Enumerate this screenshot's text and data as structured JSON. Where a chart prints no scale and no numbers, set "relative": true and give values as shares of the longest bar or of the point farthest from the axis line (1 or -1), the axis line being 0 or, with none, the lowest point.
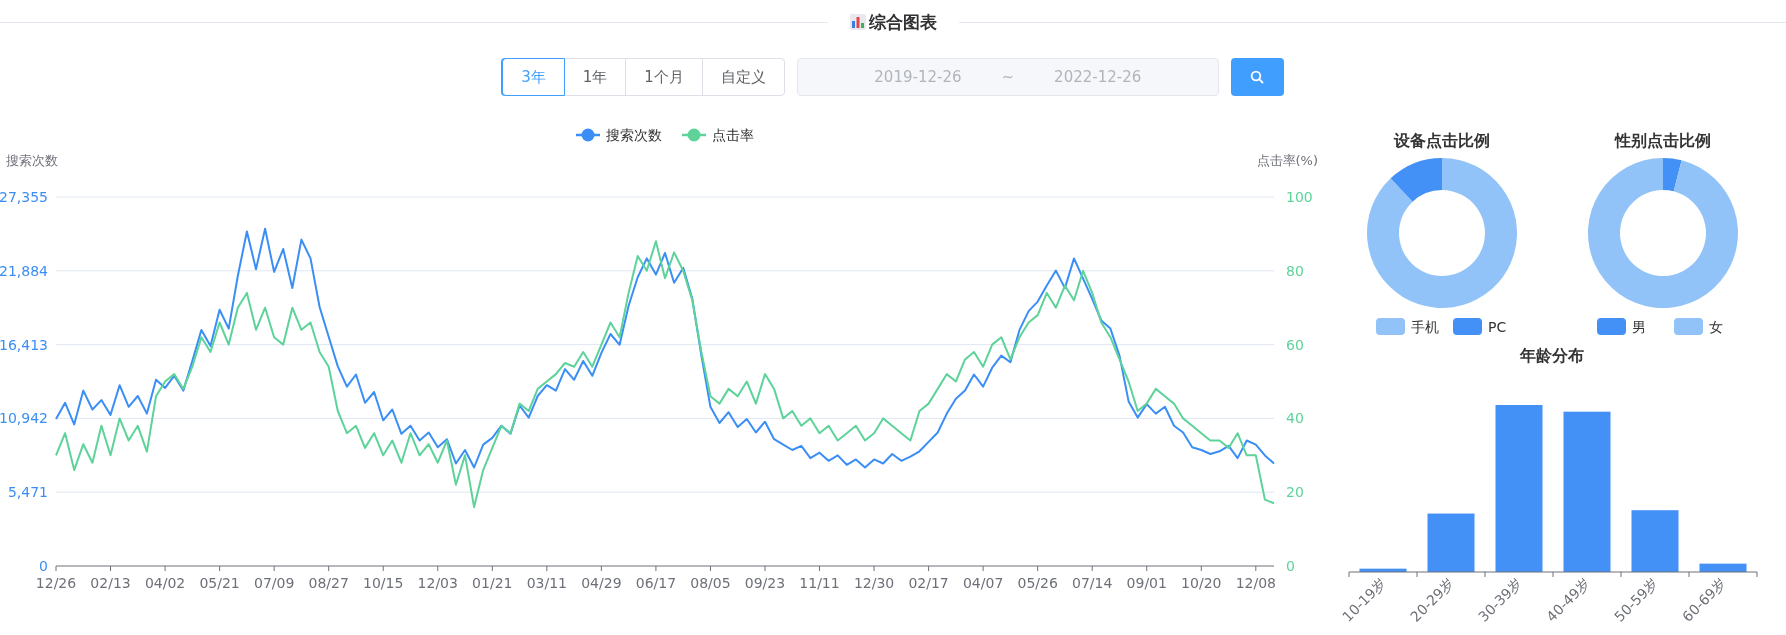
{
  "header": {
    "title": "综合图表"
  },
  "range_tabs": [
    {
      "label": "3年",
      "selected": true
    },
    {
      "label": "1年",
      "selected": false
    },
    {
      "label": "1个月",
      "selected": false
    },
    {
      "label": "自定义",
      "selected": false
    }
  ],
  "date_range": {
    "start": "2019-12-26",
    "separator": "~",
    "end": "2022-12-26",
    "disabled": true
  },
  "trend_chart": {
    "chart_data": {
      "type": "line",
      "legend": "top",
      "grid": true,
      "ylabel": "搜索次数",
      "y2label": "点击率(%)",
      "ylim": [
        0,
        27355
      ],
      "y2lim": [
        0,
        100
      ],
      "categories": [
        "12/26",
        null,
        null,
        null,
        null,
        null,
        "02/13",
        null,
        null,
        null,
        null,
        null,
        "04/02",
        null,
        null,
        null,
        null,
        null,
        "05/21",
        null,
        null,
        null,
        null,
        null,
        "07/09",
        null,
        null,
        null,
        null,
        null,
        "08/27",
        null,
        null,
        null,
        null,
        null,
        "10/15",
        null,
        null,
        null,
        null,
        null,
        "12/03",
        null,
        null,
        null,
        null,
        null,
        "01/21",
        null,
        null,
        null,
        null,
        null,
        "03/11",
        null,
        null,
        null,
        null,
        null,
        "04/29",
        null,
        null,
        null,
        null,
        null,
        "06/17",
        null,
        null,
        null,
        null,
        null,
        "08/05",
        null,
        null,
        null,
        null,
        null,
        "09/23",
        null,
        null,
        null,
        null,
        null,
        "11/11",
        null,
        null,
        null,
        null,
        null,
        "12/30",
        null,
        null,
        null,
        null,
        null,
        "02/17",
        null,
        null,
        null,
        null,
        null,
        "04/07",
        null,
        null,
        null,
        null,
        null,
        "05/26",
        null,
        null,
        null,
        null,
        null,
        "07/14",
        null,
        null,
        null,
        null,
        null,
        "09/01",
        null,
        null,
        null,
        null,
        null,
        "10/20",
        null,
        null,
        null,
        null,
        null,
        "12/08",
        null,
        null
      ],
      "yticks": [
        {
          "value": 0,
          "label": "0"
        },
        {
          "value": 5471,
          "label": "5,471"
        },
        {
          "value": 10942,
          "label": "10,942"
        },
        {
          "value": 16413,
          "label": "16,413"
        },
        {
          "value": 21884,
          "label": "21,884"
        },
        {
          "value": 27355,
          "label": "27,355"
        }
      ],
      "y2ticks": [
        0,
        20,
        40,
        60,
        80,
        100
      ],
      "series": [
        {
          "name": "搜索次数",
          "color": "#3a8ef5",
          "values": [
            10900,
            12100,
            10500,
            13000,
            11600,
            12300,
            11200,
            13400,
            11800,
            12600,
            11300,
            13800,
            13200,
            14100,
            13000,
            15200,
            17500,
            16300,
            19000,
            17600,
            21500,
            24800,
            22000,
            25000,
            21800,
            23500,
            20600,
            24200,
            22800,
            19200,
            17000,
            14800,
            13300,
            14200,
            12100,
            12900,
            10800,
            11600,
            9800,
            10400,
            9300,
            9900,
            8800,
            9400,
            7600,
            8600,
            7300,
            9000,
            9500,
            10400,
            9800,
            11900,
            11000,
            12600,
            13400,
            13000,
            14600,
            13800,
            15200,
            14100,
            15800,
            17200,
            16400,
            19300,
            21400,
            22800,
            21600,
            23200,
            21000,
            22100,
            19800,
            15600,
            11800,
            10600,
            11400,
            10300,
            10900,
            9900,
            10700,
            9400,
            9000,
            8600,
            8900,
            8000,
            8400,
            7800,
            8200,
            7500,
            7900,
            7300,
            7900,
            7600,
            8300,
            7800,
            8100,
            8500,
            9200,
            9900,
            11300,
            12400,
            13000,
            14200,
            13300,
            14700,
            15600,
            15100,
            17500,
            18900,
            19600,
            20800,
            21900,
            20600,
            22800,
            21300,
            19800,
            18200,
            17600,
            15600,
            12200,
            11000,
            12000,
            11300,
            11800,
            10400,
            9900,
            8800,
            8600,
            8300,
            8500,
            8900,
            8000,
            9300,
            9000,
            8200,
            7600
          ]
        },
        {
          "name": "点击率",
          "color": "#5dd39a",
          "axis": "y2",
          "values": [
            30,
            36,
            26,
            33,
            28,
            38,
            30,
            40,
            34,
            38,
            31,
            46,
            50,
            52,
            48,
            54,
            62,
            58,
            66,
            60,
            70,
            74,
            64,
            70,
            62,
            60,
            70,
            64,
            66,
            58,
            54,
            42,
            36,
            38,
            32,
            36,
            30,
            34,
            28,
            36,
            30,
            33,
            28,
            34,
            22,
            30,
            16,
            26,
            32,
            38,
            36,
            44,
            42,
            48,
            50,
            52,
            55,
            54,
            58,
            54,
            60,
            66,
            62,
            74,
            84,
            80,
            88,
            78,
            85,
            80,
            72,
            58,
            46,
            44,
            48,
            46,
            50,
            44,
            52,
            48,
            40,
            42,
            38,
            40,
            36,
            38,
            34,
            36,
            38,
            34,
            36,
            40,
            38,
            36,
            34,
            42,
            44,
            48,
            52,
            50,
            56,
            58,
            54,
            60,
            62,
            56,
            62,
            66,
            68,
            74,
            70,
            76,
            72,
            80,
            74,
            66,
            62,
            56,
            50,
            42,
            44,
            48,
            46,
            44,
            40,
            38,
            36,
            34,
            34,
            32,
            36,
            30,
            30,
            18,
            17
          ]
        }
      ]
    }
  },
  "device_chart": {
    "chart_data": {
      "type": "donut",
      "title": "设备点击比例",
      "legend": "bottom",
      "categories": [
        "手机",
        "PC"
      ],
      "values": [
        88,
        12
      ],
      "colors": [
        "#91c2f8",
        "#4390f6"
      ]
    }
  },
  "gender_chart": {
    "chart_data": {
      "type": "donut",
      "title": "性别点击比例",
      "legend": "bottom",
      "categories": [
        "男",
        "女"
      ],
      "values": [
        4,
        96
      ],
      "colors": [
        "#4390f6",
        "#91c2f8"
      ]
    }
  },
  "age_chart": {
    "chart_data": {
      "type": "bar",
      "title": "年龄分布",
      "categories": [
        "10-19岁",
        "20-29岁",
        "30-39岁",
        "40-49岁",
        "50-59岁",
        "60-69岁"
      ],
      "values": [
        0.02,
        0.35,
        1,
        0.96,
        0.37,
        0.05
      ],
      "relative": true,
      "color": "#4390f6"
    }
  }
}
